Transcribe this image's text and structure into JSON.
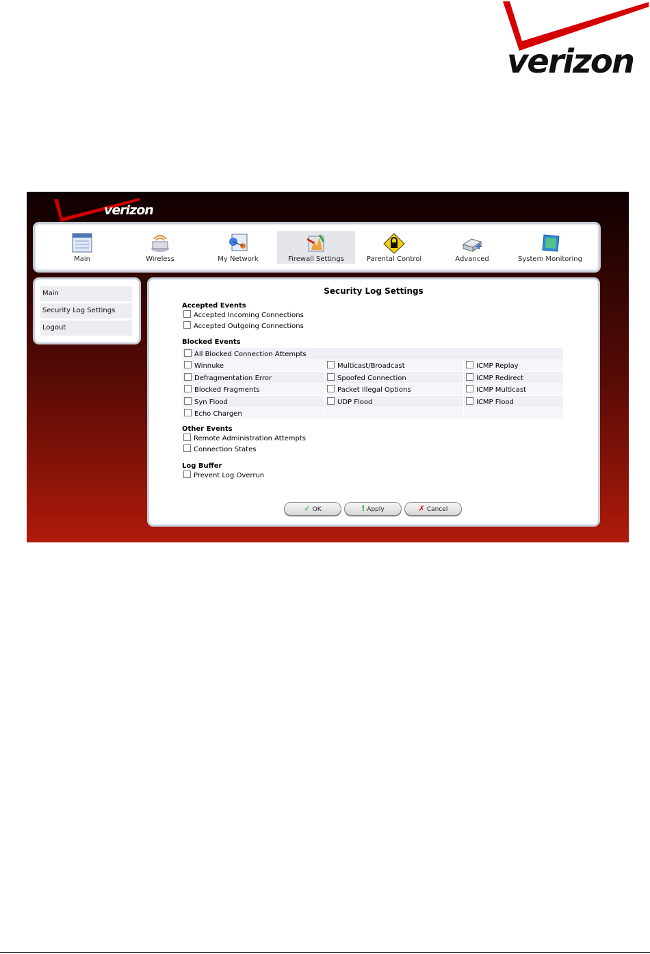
{
  "brand": {
    "logo_text": "verizon",
    "accent": "#cc0000"
  },
  "nav": {
    "items": [
      {
        "label": "Main",
        "icon": "main-icon"
      },
      {
        "label": "Wireless",
        "icon": "wireless-icon"
      },
      {
        "label": "My Network",
        "icon": "my-network-icon"
      },
      {
        "label": "Firewall Settings",
        "icon": "firewall-icon"
      },
      {
        "label": "Parental Control",
        "icon": "parental-control-icon"
      },
      {
        "label": "Advanced",
        "icon": "advanced-icon"
      },
      {
        "label": "System Monitoring",
        "icon": "system-monitoring-icon"
      }
    ],
    "active": "Firewall Settings"
  },
  "sidebar": {
    "items": [
      {
        "label": "Main"
      },
      {
        "label": "Security Log Settings"
      },
      {
        "label": "Logout"
      }
    ]
  },
  "main": {
    "title": "Security Log Settings",
    "accepted": {
      "heading": "Accepted Events",
      "options": [
        "Accepted Incoming Connections",
        "Accepted Outgoing Connections"
      ]
    },
    "blocked": {
      "heading": "Blocked Events",
      "all": "All Blocked Connection Attempts",
      "rows": [
        [
          "Winnuke",
          "Multicast/Broadcast",
          "ICMP Replay"
        ],
        [
          "Defragmentation Error",
          "Spoofed Connection",
          "ICMP Redirect"
        ],
        [
          "Blocked Fragments",
          "Packet Illegal Options",
          "ICMP Multicast"
        ],
        [
          "Syn Flood",
          "UDP Flood",
          "ICMP Flood"
        ],
        [
          "Echo Chargen",
          "",
          ""
        ]
      ]
    },
    "other": {
      "heading": "Other Events",
      "options": [
        "Remote Administration Attempts",
        "Connection States"
      ]
    },
    "buffer": {
      "heading": "Log Buffer",
      "options": [
        "Prevent Log Overrun"
      ]
    },
    "buttons": {
      "ok": "OK",
      "apply": "Apply",
      "cancel": "Cancel"
    }
  }
}
